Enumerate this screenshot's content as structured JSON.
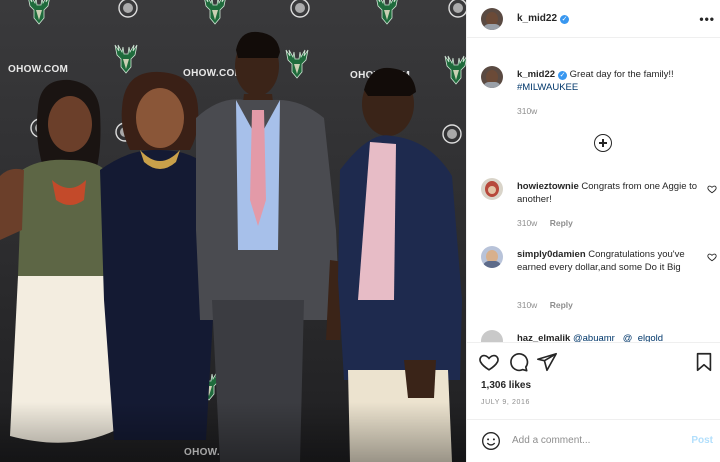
{
  "photo": {
    "backdrop_text": "OHOW.COM",
    "description_colors": {
      "wall": "#2c2c2e",
      "accent": "#1c6b3a"
    }
  },
  "post": {
    "username": "k_mid22",
    "more_icon": "more-horizontal-icon",
    "caption": {
      "username": "k_mid22",
      "text": "Great day for the family!!",
      "hashtag": "#MILWAUKEE",
      "time": "310w"
    },
    "load_more_icon": "plus-circle-icon",
    "comments": [
      {
        "username": "howieztownie",
        "text": "Congrats from one Aggie to another!",
        "time": "310w",
        "reply": "Reply"
      },
      {
        "username": "simply0damien",
        "text": "Congratulations you've earned every dollar,and some Do it Big",
        "time": "310w",
        "reply": "Reply"
      },
      {
        "username": "haz_elmalik",
        "text": "@abuamr_ @_elgold",
        "time": "",
        "reply": ""
      }
    ],
    "likes": "1,306 likes",
    "date": "JULY 9, 2016",
    "add_comment": {
      "placeholder": "Add a comment...",
      "post_label": "Post"
    },
    "colors": {
      "verified": "#3897f0",
      "link": "#00376b",
      "post_disabled": "#b2dffc"
    }
  }
}
